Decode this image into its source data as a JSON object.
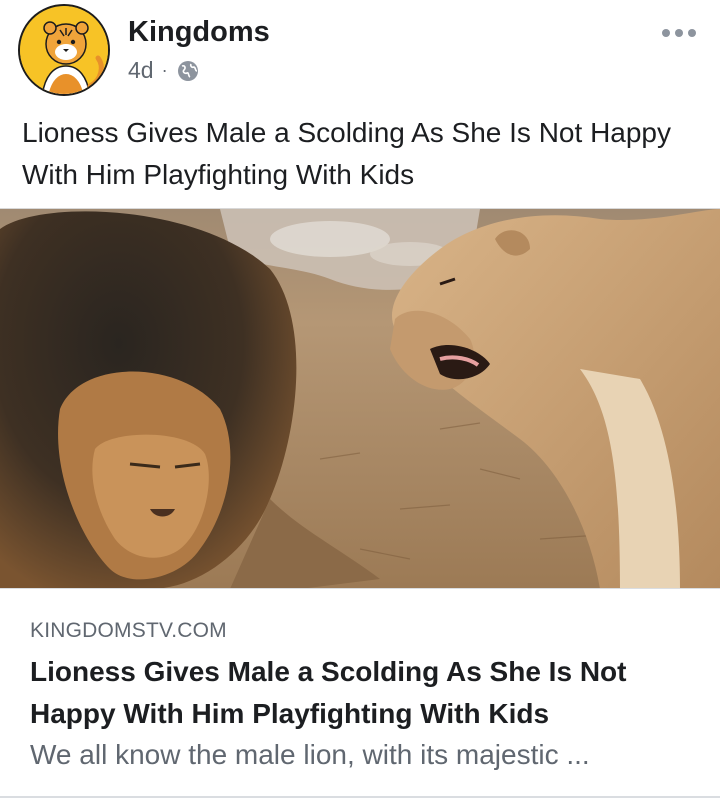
{
  "post": {
    "page_name": "Kingdoms",
    "timestamp": "4d",
    "separator": "·",
    "privacy_icon": "globe-icon",
    "more_icon": "more-horizontal-icon",
    "text": "Lioness Gives Male a Scolding As She Is Not Happy With Him Playfighting With Kids"
  },
  "link_preview": {
    "domain": "KINGDOMSTV.COM",
    "title": "Lioness Gives Male a Scolding As She Is Not Happy With Him Playfighting With Kids",
    "description": "We all know the male lion, with its majestic ..."
  },
  "colors": {
    "avatar_bg": "#f7c326",
    "text_primary": "#1c1e21",
    "text_secondary": "#606770",
    "divider": "#dadde1"
  }
}
